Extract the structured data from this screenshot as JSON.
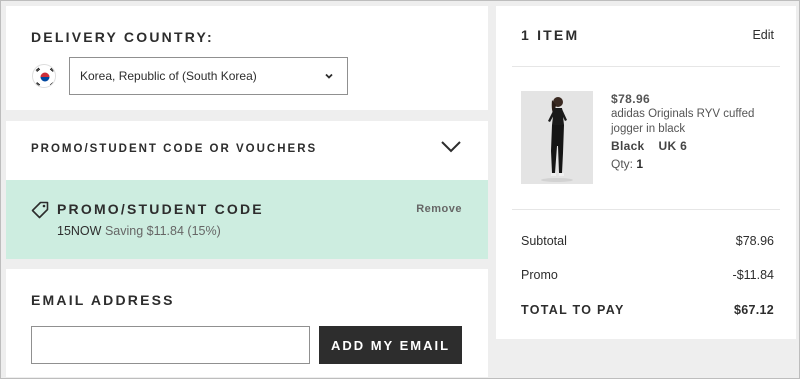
{
  "delivery": {
    "heading": "DELIVERY COUNTRY:",
    "selected_country": "Korea, Republic of (South Korea)"
  },
  "promo": {
    "heading": "PROMO/STUDENT CODE OR VOUCHERS",
    "applied_heading": "PROMO/STUDENT CODE",
    "code": "15NOW",
    "saving_text": "Saving $11.84 (15%)",
    "remove_label": "Remove",
    "applied_bg_color": "#cdede0"
  },
  "email": {
    "heading": "EMAIL ADDRESS",
    "input_value": "",
    "button_label": "ADD MY EMAIL"
  },
  "summary": {
    "title": "1 ITEM",
    "edit_label": "Edit",
    "item": {
      "price": "$78.96",
      "name": "adidas Originals RYV cuffed jogger in black",
      "color": "Black",
      "size": "UK 6",
      "qty_label": "Qty:",
      "qty": "1"
    },
    "subtotal_label": "Subtotal",
    "subtotal_value": "$78.96",
    "promo_label": "Promo",
    "promo_value": "-$11.84",
    "total_label": "TOTAL TO PAY",
    "total_value": "$67.12"
  }
}
